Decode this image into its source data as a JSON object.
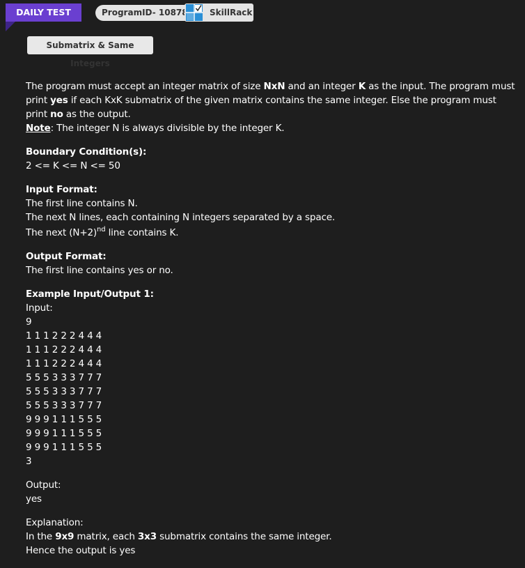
{
  "header": {
    "badge": "DAILY TEST",
    "program_id": "ProgramID- 10878",
    "brand": "SkillRack",
    "title": "Submatrix & Same Integers"
  },
  "problem": {
    "desc": {
      "t1": "The program must accept an integer matrix of size ",
      "b1": "NxN",
      "t2": " and an integer ",
      "b2": "K",
      "t3": " as the input. The program must print ",
      "b3": "yes",
      "t4": " if each KxK submatrix of the given matrix contains the same integer. Else the program must print ",
      "b4": "no",
      "t5": " as the output."
    },
    "note_label": "Note",
    "note_text": ": The integer N is always divisible by the integer K.",
    "boundary_heading": "Boundary Condition(s):",
    "boundary_text": "2 <= K <= N <= 50",
    "input_heading": "Input Format:",
    "input_lines": {
      "l1": "The first line contains N.",
      "l2": "The next N lines, each containing N integers separated by a space.",
      "l3_pre": "The next (N+2)",
      "l3_sup": "nd",
      "l3_post": " line contains K."
    },
    "output_heading": "Output Format:",
    "output_text": "The first line contains yes or no."
  },
  "example": {
    "heading": "Example Input/Output 1:",
    "input_label": "Input:",
    "lines": [
      "9",
      "1 1 1 2 2 2 4 4 4",
      "1 1 1 2 2 2 4 4 4",
      "1 1 1 2 2 2 4 4 4",
      "5 5 5 3 3 3 7 7 7",
      "5 5 5 3 3 3 7 7 7",
      "5 5 5 3 3 3 7 7 7",
      "9 9 9 1 1 1 5 5 5",
      "9 9 9 1 1 1 5 5 5",
      "9 9 9 1 1 1 5 5 5",
      "3"
    ],
    "output_label": "Output:",
    "output_value": "yes",
    "explanation_label": "Explanation:",
    "explanation": {
      "t1": "In the ",
      "b1": "9x9",
      "t2": " matrix, each ",
      "b2": "3x3",
      "t3": " submatrix contains the same integer."
    },
    "explanation_line2": "Hence the output is yes"
  },
  "colors": {
    "background": "#1e1e1e",
    "badge": "#6a3fd0",
    "text": "#ffffff",
    "logo_blue": "#2a8fd6"
  },
  "icons": {
    "logo": "skillrack-logo-icon"
  }
}
